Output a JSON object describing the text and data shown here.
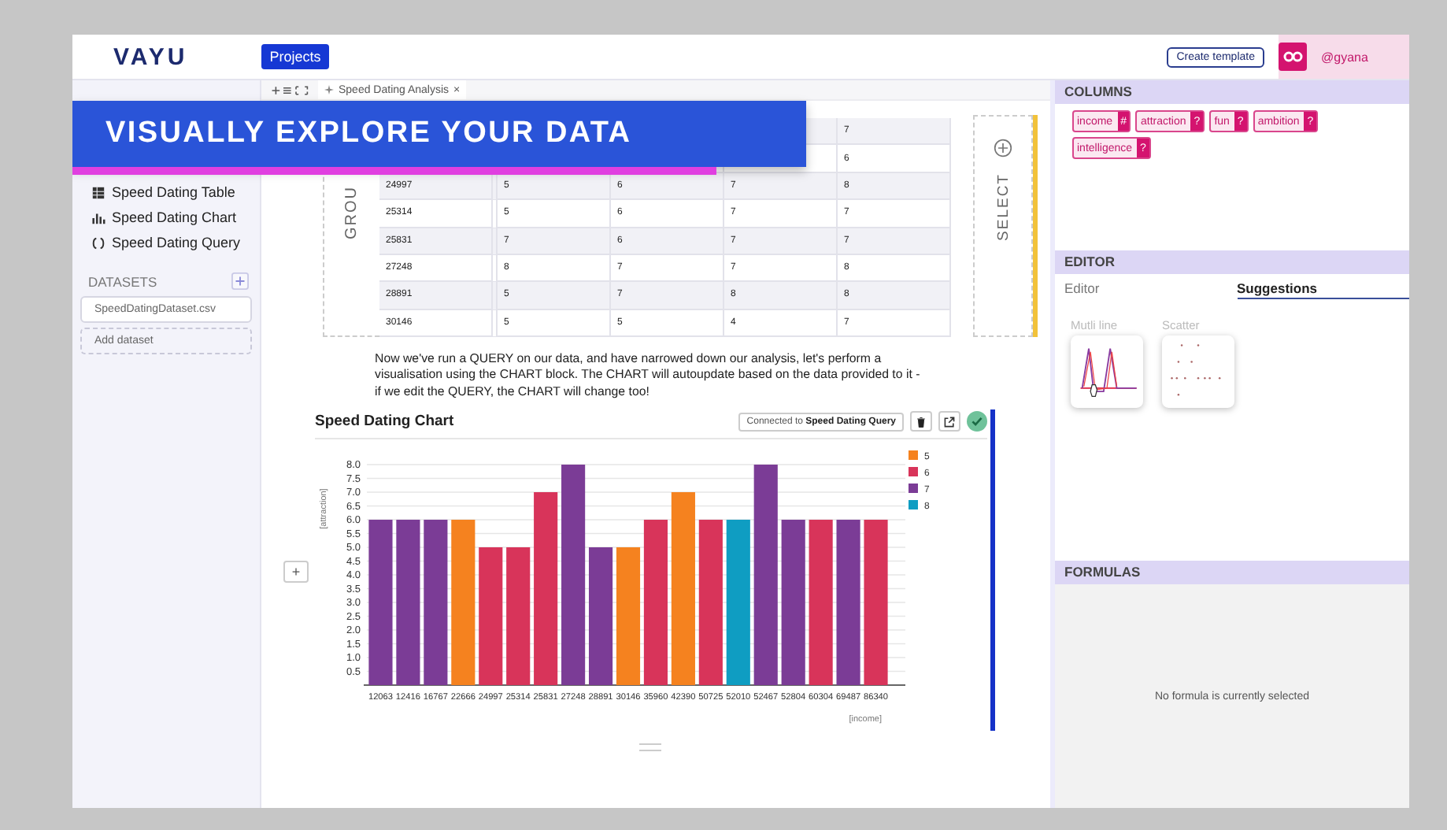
{
  "topbar": {
    "logo": "VAYU",
    "projects_button": "Projects",
    "create_template_button": "Create template",
    "user": "@gyana"
  },
  "banner": {
    "title": "VISUALLY EXPLORE YOUR DATA"
  },
  "sidebar": {
    "items": [
      {
        "label": "Speed Dating Table",
        "kind": "table"
      },
      {
        "label": "Speed Dating Chart",
        "kind": "chart"
      },
      {
        "label": "Speed Dating Query",
        "kind": "query"
      }
    ],
    "datasets_heading": "DATASETS",
    "datasets": [
      "SpeedDatingDataset.csv"
    ],
    "add_dataset": "Add dataset"
  },
  "tab": {
    "label": "Speed Dating Analysis",
    "close": "×"
  },
  "group_label": "GROU",
  "select_label": "SELECT",
  "table": {
    "rows": [
      {
        "cells": [
          null,
          null,
          null,
          null,
          "7"
        ]
      },
      {
        "cells": [
          null,
          null,
          null,
          null,
          "6"
        ]
      },
      {
        "cells": [
          "24997",
          "5",
          "6",
          "7",
          "8"
        ]
      },
      {
        "cells": [
          "25314",
          "5",
          "6",
          "7",
          "7"
        ]
      },
      {
        "cells": [
          "25831",
          "7",
          "6",
          "7",
          "7"
        ]
      },
      {
        "cells": [
          "27248",
          "8",
          "7",
          "7",
          "8"
        ]
      },
      {
        "cells": [
          "28891",
          "5",
          "7",
          "8",
          "8"
        ]
      },
      {
        "cells": [
          "30146",
          "5",
          "5",
          "4",
          "7"
        ]
      }
    ]
  },
  "paragraph": "Now we've run a QUERY on our data, and have narrowed down our analysis, let's perform a visualisation using the CHART block. The CHART will autoupdate based on the data provided to it - if we edit the QUERY, the CHART will change too!",
  "chart_block": {
    "title": "Speed Dating Chart",
    "connected_prefix": "Connected to",
    "connected_source": "Speed Dating Query",
    "status_ok": true,
    "chart_data": {
      "type": "bar",
      "xlabel": "[income]",
      "ylabel": "[attraction]",
      "stacked": true,
      "grid": true,
      "legend": true,
      "categories": [
        "12063",
        "12416",
        "16767",
        "22666",
        "24997",
        "25314",
        "25831",
        "27248",
        "28891",
        "30146",
        "35960",
        "42390",
        "50725",
        "52010",
        "52467",
        "52804",
        "60304",
        "69487",
        "86340"
      ],
      "ylim": [
        0,
        8
      ],
      "yticks": [
        {
          "value": 0.5,
          "label": "0.5"
        },
        {
          "value": 1,
          "label": "1.0"
        },
        {
          "value": 1.5,
          "label": "1.5"
        },
        {
          "value": 2,
          "label": "2.0"
        },
        {
          "value": 2.5,
          "label": "2.5"
        },
        {
          "value": 3,
          "label": "3.0"
        },
        {
          "value": 3.5,
          "label": "3.5"
        },
        {
          "value": 4,
          "label": "4.0"
        },
        {
          "value": 4.5,
          "label": "4.5"
        },
        {
          "value": 5,
          "label": "5.0"
        },
        {
          "value": 5.5,
          "label": "5.5"
        },
        {
          "value": 6,
          "label": "6.0"
        },
        {
          "value": 6.5,
          "label": "6.5"
        },
        {
          "value": 7,
          "label": "7.0"
        },
        {
          "value": 7.5,
          "label": "7.5"
        },
        {
          "value": 8,
          "label": "8.0"
        }
      ],
      "series": [
        {
          "name": "5",
          "color": "#f5821f",
          "values": [
            null,
            null,
            null,
            6,
            null,
            null,
            null,
            null,
            null,
            5,
            null,
            7,
            null,
            null,
            null,
            null,
            null,
            null,
            null
          ]
        },
        {
          "name": "6",
          "color": "#d8345a",
          "values": [
            null,
            null,
            null,
            null,
            5,
            5,
            7,
            null,
            null,
            null,
            6,
            null,
            6,
            null,
            null,
            null,
            6,
            null,
            6
          ]
        },
        {
          "name": "7",
          "color": "#7b3c96",
          "values": [
            6,
            6,
            6,
            null,
            null,
            null,
            null,
            8,
            5,
            null,
            null,
            null,
            null,
            null,
            8,
            6,
            null,
            6,
            null
          ]
        },
        {
          "name": "8",
          "color": "#0f9dc2",
          "values": [
            null,
            null,
            null,
            null,
            null,
            null,
            null,
            null,
            null,
            null,
            null,
            null,
            null,
            6,
            null,
            null,
            null,
            null,
            null
          ]
        }
      ]
    }
  },
  "add_block_button": "+",
  "columns_panel": {
    "heading": "COLUMNS",
    "tags": [
      {
        "label": "income",
        "type": "#"
      },
      {
        "label": "attraction",
        "type": "?"
      },
      {
        "label": "fun",
        "type": "?"
      },
      {
        "label": "ambition",
        "type": "?"
      },
      {
        "label": "intelligence",
        "type": "?"
      }
    ]
  },
  "editor_panel": {
    "heading": "EDITOR",
    "tabs": [
      {
        "label": "Editor",
        "selected": false
      },
      {
        "label": "Suggestions",
        "selected": true
      }
    ],
    "suggestions": [
      {
        "label": "Mutli line",
        "kind": "multiline"
      },
      {
        "label": "Scatter",
        "kind": "scatter"
      }
    ]
  },
  "formulas_panel": {
    "heading": "FORMULAS",
    "empty_message": "No formula is currently selected"
  }
}
